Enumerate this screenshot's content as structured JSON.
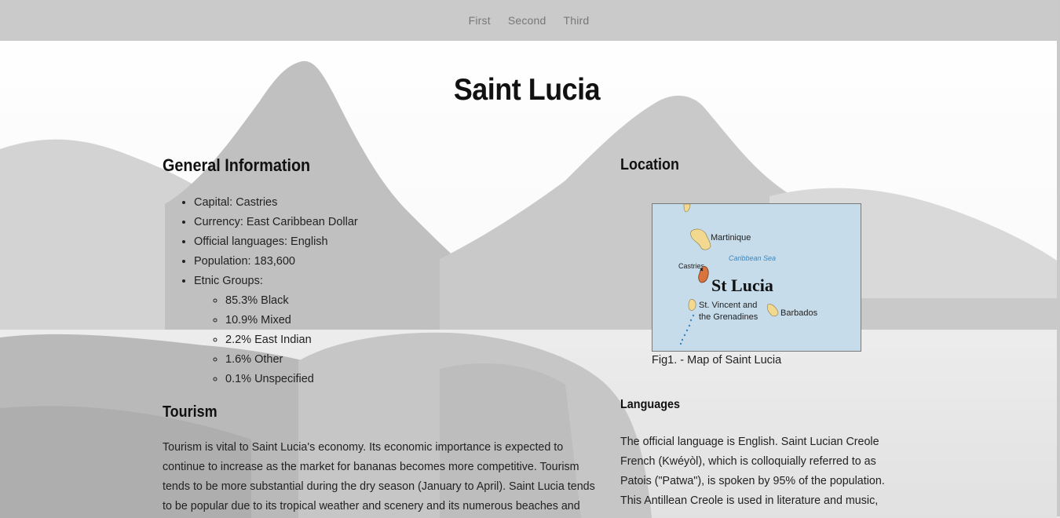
{
  "nav": {
    "items": [
      "First",
      "Second",
      "Third"
    ]
  },
  "title": "Saint Lucia",
  "general": {
    "heading": "General Information",
    "items": [
      "Capital: Castries",
      "Currency: East Caribbean Dollar",
      "Official languages: English",
      "Population: 183,600",
      "Etnic Groups:"
    ],
    "ethnic_groups": [
      "85.3% Black",
      "10.9% Mixed",
      "2.2% East Indian",
      "1.6% Other",
      "0.1% Unspecified"
    ]
  },
  "tourism": {
    "heading": "Tourism",
    "text": "Tourism is vital to Saint Lucia's economy. Its economic importance is expected to continue to increase as the market for bananas becomes more competitive. Tourism tends to be more substantial during the dry season (January to April). Saint Lucia tends to be popular due to its tropical weather and scenery and its numerous beaches and"
  },
  "location": {
    "heading": "Location",
    "map_labels": {
      "martinique": "Martinique",
      "caribbean_sea": "Caribbean Sea",
      "castries": "Castries",
      "st_lucia": "St Lucia",
      "st_vincent_1": "St. Vincent and",
      "st_vincent_2": "the Grenadines",
      "barbados": "Barbados"
    },
    "caption": "Fig1. - Map of Saint Lucia"
  },
  "languages": {
    "heading": "Languages",
    "text": "The official language is English. Saint Lucian Creole French (Kwéyòl), which is colloquially referred to as Patois (\"Patwa\"), is spoken by 95% of the population. This Antillean Creole is used in literature and music,"
  },
  "colors": {
    "nav_bg": "#cacaca",
    "map_sea": "#c7dcea",
    "island": "#f3d98f",
    "st_lucia_fill": "#d9743f"
  }
}
